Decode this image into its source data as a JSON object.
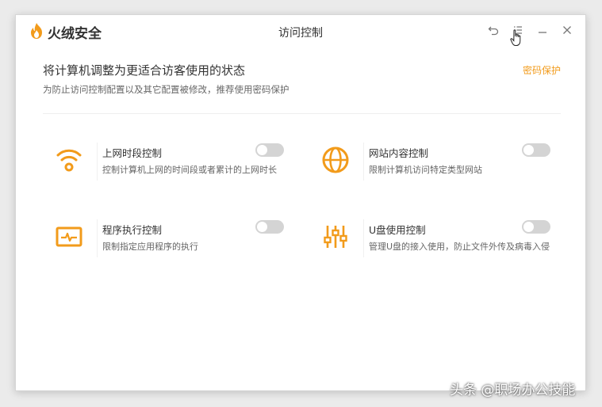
{
  "app": {
    "brand": "火绒安全",
    "window_title": "访问控制"
  },
  "header": {
    "title": "将计算机调整为更适合访客使用的状态",
    "subtitle": "为防止访问控制配置以及其它配置被修改，推荐使用密码保护",
    "password_link": "密码保护"
  },
  "controls": [
    {
      "name": "上网时段控制",
      "desc": "控制计算机上网的时间段或者累计的上网时长",
      "icon": "wifi-icon",
      "enabled": false
    },
    {
      "name": "网站内容控制",
      "desc": "限制计算机访问特定类型网站",
      "icon": "globe-icon",
      "enabled": false
    },
    {
      "name": "程序执行控制",
      "desc": "限制指定应用程序的执行",
      "icon": "program-monitor-icon",
      "enabled": false
    },
    {
      "name": "U盘使用控制",
      "desc": "管理U盘的接入使用，防止文件外传及病毒入侵",
      "icon": "sliders-icon",
      "enabled": false
    }
  ],
  "colors": {
    "accent": "#f29b1b",
    "toggle_off": "#d4d4d4"
  },
  "watermark": "头条 @职场办公技能"
}
